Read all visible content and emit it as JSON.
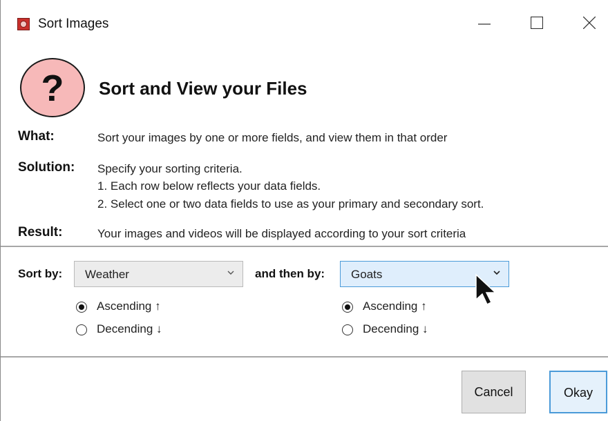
{
  "window": {
    "title": "Sort Images"
  },
  "header": {
    "icon_glyph": "?",
    "title": "Sort and View your Files"
  },
  "info": {
    "what_label": "What:",
    "what_text": "Sort your images by one or more fields, and view them in that order",
    "solution_label": "Solution:",
    "solution_lines": [
      "Specify your sorting criteria.",
      "1. Each row below reflects your data fields.",
      "2. Select one or two data fields to use as your primary and secondary sort."
    ],
    "result_label": "Result:",
    "result_text": "Your images and videos will be displayed according to your sort criteria"
  },
  "sort": {
    "primary": {
      "label": "Sort by:",
      "value": "Weather",
      "ascending_label": "Ascending ↑",
      "descending_label": "Decending ↓",
      "selected": "ascending"
    },
    "secondary": {
      "label": "and then by:",
      "value": "Goats",
      "ascending_label": "Ascending ↑",
      "descending_label": "Decending ↓",
      "selected": "ascending"
    }
  },
  "buttons": {
    "cancel": "Cancel",
    "okay": "Okay"
  },
  "icons": {
    "app": "app-icon",
    "help": "question-icon",
    "minimize": "minimize-icon",
    "maximize": "maximize-icon",
    "close": "close-icon",
    "dropdown": "chevron-down-icon",
    "cursor": "mouse-cursor-icon"
  },
  "colors": {
    "help_icon_fill": "#f7b9b9",
    "focus_border": "#4a9ad8",
    "focus_fill": "#dfeefc"
  }
}
